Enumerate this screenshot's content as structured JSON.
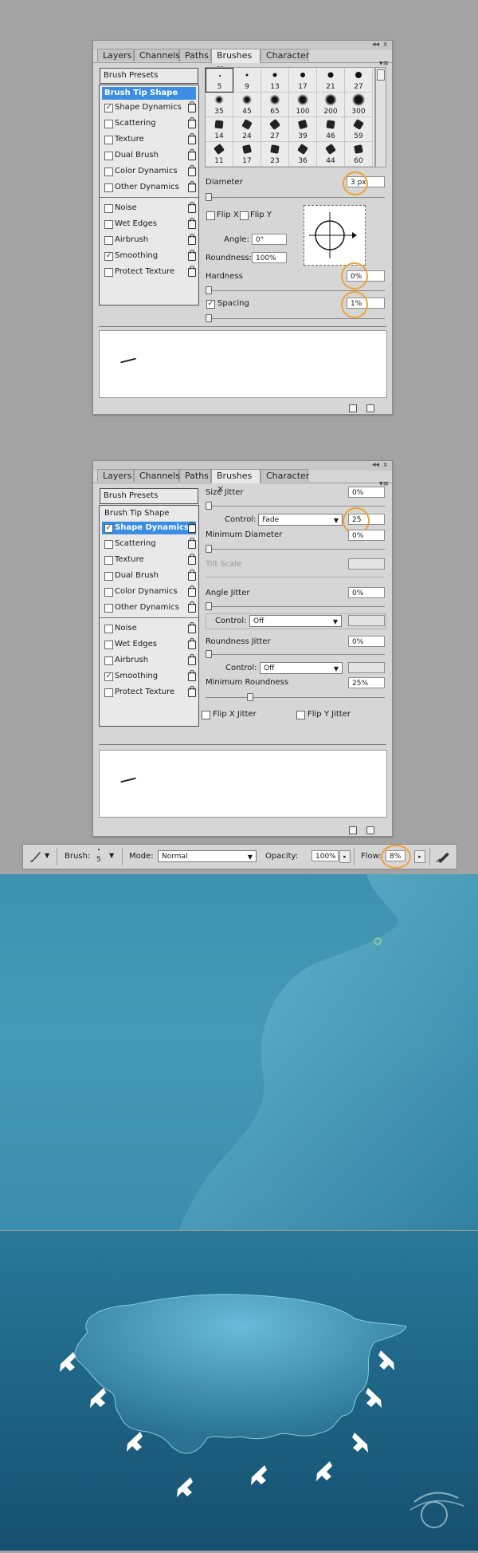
{
  "panel1": {
    "tabs": [
      "Layers",
      "Channels",
      "Paths",
      "Brushes",
      "Character"
    ],
    "close_glyph": "×",
    "menu_glyph": "▾≡",
    "win_glyphs": [
      "◂◂",
      "x"
    ],
    "brush_presets_label": "Brush Presets",
    "options": [
      {
        "label": "Brush Tip Shape",
        "selected": true,
        "checkable": false,
        "lock": false
      },
      {
        "label": "Shape Dynamics",
        "checked": true,
        "lock": true
      },
      {
        "label": "Scattering",
        "checked": false,
        "lock": true
      },
      {
        "label": "Texture",
        "checked": false,
        "lock": true
      },
      {
        "label": "Dual Brush",
        "checked": false,
        "lock": true
      },
      {
        "label": "Color Dynamics",
        "checked": false,
        "lock": true
      },
      {
        "label": "Other Dynamics",
        "checked": false,
        "lock": true
      },
      {
        "label": "Noise",
        "checked": false,
        "lock": true
      },
      {
        "label": "Wet Edges",
        "checked": false,
        "lock": true
      },
      {
        "label": "Airbrush",
        "checked": false,
        "lock": true
      },
      {
        "label": "Smoothing",
        "checked": true,
        "lock": true
      },
      {
        "label": "Protect Texture",
        "checked": false,
        "lock": true
      }
    ],
    "brush_sizes": [
      "5",
      "9",
      "13",
      "17",
      "21",
      "27",
      "35",
      "45",
      "65",
      "100",
      "200",
      "300",
      "14",
      "24",
      "27",
      "39",
      "46",
      "59",
      "11",
      "17",
      "23",
      "36",
      "44",
      "60"
    ],
    "diameter_label": "Diameter",
    "diameter_value": "3 px",
    "flipx_label": "Flip X",
    "flipy_label": "Flip Y",
    "angle_label": "Angle:",
    "angle_value": "0°",
    "roundness_label": "Roundness:",
    "roundness_value": "100%",
    "hardness_label": "Hardness",
    "hardness_value": "0%",
    "spacing_label": "Spacing",
    "spacing_value": "1%"
  },
  "panel2": {
    "tabs": [
      "Layers",
      "Channels",
      "Paths",
      "Brushes",
      "Character"
    ],
    "close_glyph": "×",
    "menu_glyph": "▾≡",
    "win_glyphs": [
      "◂◂",
      "x"
    ],
    "brush_presets_label": "Brush Presets",
    "options": [
      {
        "label": "Brush Tip Shape",
        "selected": false,
        "checkable": false,
        "lock": false
      },
      {
        "label": "Shape Dynamics",
        "checked": true,
        "selected": true,
        "lock": true
      },
      {
        "label": "Scattering",
        "checked": false,
        "lock": true
      },
      {
        "label": "Texture",
        "checked": false,
        "lock": true
      },
      {
        "label": "Dual Brush",
        "checked": false,
        "lock": true
      },
      {
        "label": "Color Dynamics",
        "checked": false,
        "lock": true
      },
      {
        "label": "Other Dynamics",
        "checked": false,
        "lock": true
      },
      {
        "label": "Noise",
        "checked": false,
        "lock": true
      },
      {
        "label": "Wet Edges",
        "checked": false,
        "lock": true
      },
      {
        "label": "Airbrush",
        "checked": false,
        "lock": true
      },
      {
        "label": "Smoothing",
        "checked": true,
        "lock": true
      },
      {
        "label": "Protect Texture",
        "checked": false,
        "lock": true
      }
    ],
    "size_jitter_label": "Size Jitter",
    "size_jitter_value": "0%",
    "control_label": "Control:",
    "control1_value": "Fade",
    "fade_steps_value": "25",
    "min_diameter_label": "Minimum Diameter",
    "min_diameter_value": "0%",
    "tilt_scale_label": "Tilt Scale",
    "angle_jitter_label": "Angle Jitter",
    "angle_jitter_value": "0%",
    "control2_value": "Off",
    "roundness_jitter_label": "Roundness Jitter",
    "roundness_jitter_value": "0%",
    "control3_value": "Off",
    "min_roundness_label": "Minimum Roundness",
    "min_roundness_value": "25%",
    "flipx_jitter_label": "Flip X Jitter",
    "flipy_jitter_label": "Flip Y Jitter"
  },
  "options_bar": {
    "brush_label": "Brush:",
    "brush_size": "5",
    "mode_label": "Mode:",
    "mode_value": "Normal",
    "opacity_label": "Opacity:",
    "opacity_value": "100%",
    "flow_label": "Flow:",
    "flow_value": "8%"
  },
  "check_glyph": "✓",
  "colors": {
    "accent": "#3b8ee3",
    "highlight_circle": "#f0a23a",
    "water_dark": "#16506f",
    "water_light": "#4fa3bf"
  }
}
